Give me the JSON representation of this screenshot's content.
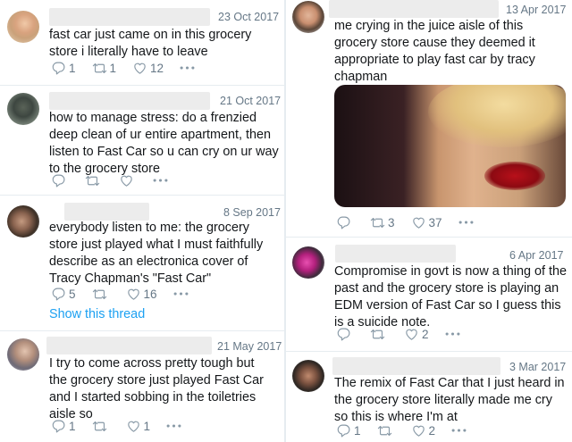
{
  "left_column": [
    {
      "date": "23 Oct 2017",
      "text": "fast car just came on in this grocery store i literally have to leave",
      "replies": "1",
      "retweets": "1",
      "likes": "12"
    },
    {
      "date": "21 Oct 2017",
      "text": "how to manage stress: do a frenzied deep clean of ur entire apartment, then listen to Fast Car so u can cry on ur way to the grocery store",
      "replies": "",
      "retweets": "",
      "likes": ""
    },
    {
      "date": "8 Sep 2017",
      "text": "everybody listen to me: the grocery store just played what I must faithfully describe as an electronica cover of Tracy Chapman's \"Fast Car\"",
      "replies": "5",
      "retweets": "",
      "likes": "16",
      "show_thread": "Show this thread"
    },
    {
      "date": "21 May 2017",
      "text": "I try to come across pretty tough but the grocery store just played Fast Car and I started sobbing in the toiletries aisle so",
      "replies": "1",
      "retweets": "",
      "likes": "1"
    }
  ],
  "right_column": [
    {
      "date": "13 Apr 2017",
      "text": "me crying in the juice aisle of this grocery store cause they deemed it appropriate to play fast car by tracy chapman",
      "replies": "",
      "retweets": "3",
      "likes": "37"
    },
    {
      "date": "6 Apr 2017",
      "text": "Compromise in govt is now a thing of the past and the grocery store is playing an EDM version of Fast Car so I guess this is a suicide note.",
      "replies": "",
      "retweets": "",
      "likes": "2"
    },
    {
      "date": "3 Mar 2017",
      "text": "The remix of Fast Car that I just heard in the grocery store literally made me cry so this is where I'm at",
      "replies": "1",
      "retweets": "",
      "likes": "2"
    }
  ],
  "icons": {
    "reply": "reply-icon",
    "retweet": "retweet-icon",
    "like": "heart-icon",
    "more": "more-dots-icon"
  },
  "colors": {
    "link": "#1da1f2",
    "muted": "#657786",
    "divider": "#e6ecf0"
  }
}
